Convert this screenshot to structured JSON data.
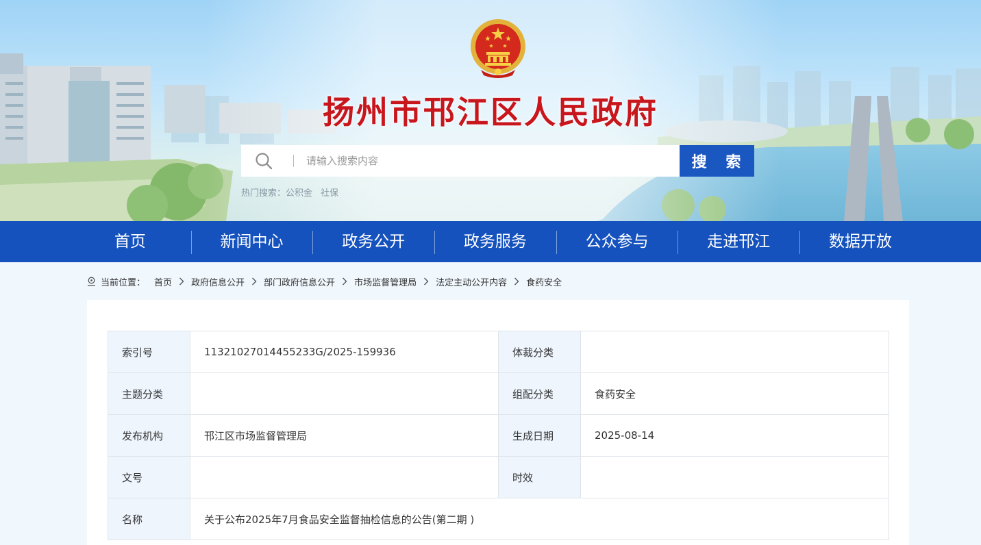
{
  "site": {
    "title": "扬州市邗江区人民政府"
  },
  "search": {
    "placeholder": "请输入搜索内容",
    "button_label": "搜 索",
    "hot_label": "热门搜索：",
    "hot_items": [
      "公积金",
      "社保"
    ]
  },
  "nav": {
    "items": [
      "首页",
      "新闻中心",
      "政务公开",
      "政务服务",
      "公众参与",
      "走进邗江",
      "数据开放"
    ]
  },
  "breadcrumb": {
    "label": "当前位置：",
    "items": [
      "首页",
      "政府信息公开",
      "部门政府信息公开",
      "市场监督管理局",
      "法定主动公开内容",
      "食药安全"
    ]
  },
  "meta": {
    "rows": [
      {
        "k1": "索引号",
        "v1": "11321027014455233G/2025-159936",
        "k2": "体裁分类",
        "v2": ""
      },
      {
        "k1": "主题分类",
        "v1": "",
        "k2": "组配分类",
        "v2": "食药安全"
      },
      {
        "k1": "发布机构",
        "v1": "邗江区市场监督管理局",
        "k2": "生成日期",
        "v2": "2025-08-14"
      },
      {
        "k1": "文号",
        "v1": "",
        "k2": "时效",
        "v2": ""
      }
    ],
    "name_label": "名称",
    "name_value": "关于公布2025年7月食品安全监督抽检信息的公告(第二期 )"
  },
  "colors": {
    "nav_bg": "#1552bd",
    "search_button": "#1a57c0",
    "title_red": "#c8161d",
    "key_cell_bg": "#eef5fd"
  },
  "icons": [
    "national-emblem-icon",
    "search-icon",
    "location-icon",
    "chevron-right-icon"
  ]
}
